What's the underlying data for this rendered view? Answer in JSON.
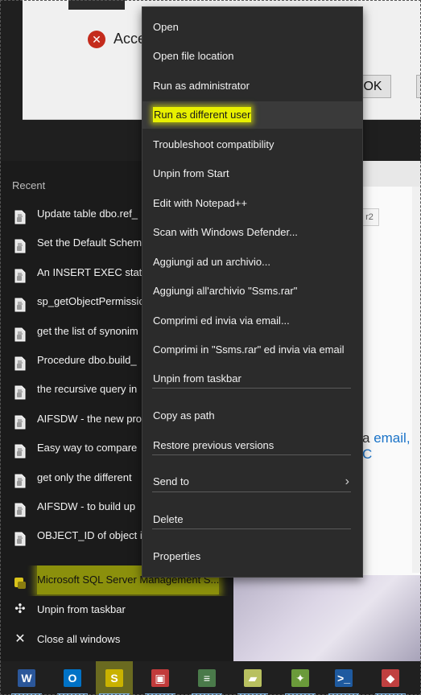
{
  "dialog": {
    "text": "Acce",
    "ok_label": "OK",
    "error_icon": "error-icon"
  },
  "web": {
    "tag": "r2",
    "link_prefix": "a ",
    "link_text": "email",
    "link_suffix": ", C"
  },
  "jump_list": {
    "header": "Recent",
    "recent": [
      "Update table dbo.ref_",
      "Set the Default Schem",
      "An INSERT EXEC state",
      "sp_getObjectPermissio",
      "get the list of synonim",
      "Procedure dbo.build_",
      "the recursive query in",
      "AIFSDW - the new pro",
      "Easy way to compare",
      "get only the different",
      "AIFSDW - to build up",
      "OBJECT_ID of object i"
    ],
    "pinned_app": "Microsoft SQL Server Management S...",
    "actions": [
      {
        "icon": "unpin-icon",
        "label": "Unpin from taskbar"
      },
      {
        "icon": "close-icon",
        "label": "Close all windows"
      }
    ]
  },
  "context_menu": {
    "items": [
      "Open",
      "Open file location",
      "Run as administrator",
      "Run as different user",
      "Troubleshoot compatibility",
      "Unpin from Start",
      "Edit with Notepad++",
      "Scan with Windows Defender...",
      "Aggiungi ad un archivio...",
      "Aggiungi all'archivio \"Ssms.rar\"",
      "Comprimi ed invia via email...",
      "Comprimi in \"Ssms.rar\" ed invia via email",
      "Unpin from taskbar",
      "Copy as path",
      "Restore previous versions",
      "Send to",
      "Delete",
      "Properties"
    ],
    "highlighted": "Run as different user"
  },
  "taskbar": {
    "apps": [
      {
        "name": "word-icon",
        "glyph": "W",
        "color": "#2b579a"
      },
      {
        "name": "outlook-icon",
        "glyph": "O",
        "color": "#0072c6"
      },
      {
        "name": "ssms-icon",
        "glyph": "S",
        "color": "#c9b200"
      },
      {
        "name": "toolbox-icon",
        "glyph": "▣",
        "color": "#c23b3b"
      },
      {
        "name": "report-icon",
        "glyph": "≡",
        "color": "#4a7a4a"
      },
      {
        "name": "eraser-icon",
        "glyph": "▰",
        "color": "#b8c060"
      },
      {
        "name": "visual-studio-icon",
        "glyph": "✦",
        "color": "#6a9a3a"
      },
      {
        "name": "powershell-icon",
        "glyph": ">_",
        "color": "#1e5aa0"
      },
      {
        "name": "tool-icon",
        "glyph": "◆",
        "color": "#c04040"
      }
    ]
  }
}
